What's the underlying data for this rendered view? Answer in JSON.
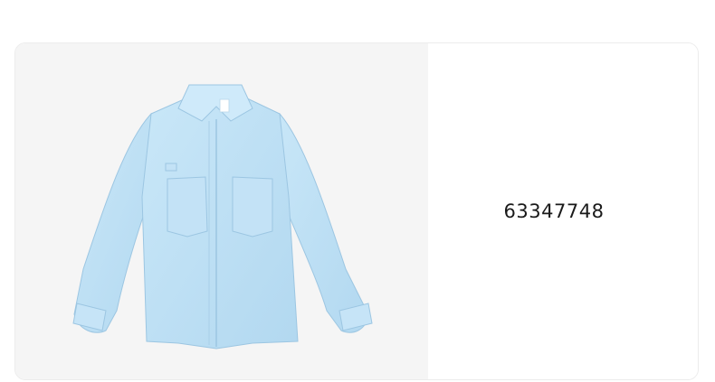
{
  "product": {
    "code": "63347748",
    "image_subject": "light-blue-button-up-shirt",
    "image_color": "#bfe0f5"
  }
}
